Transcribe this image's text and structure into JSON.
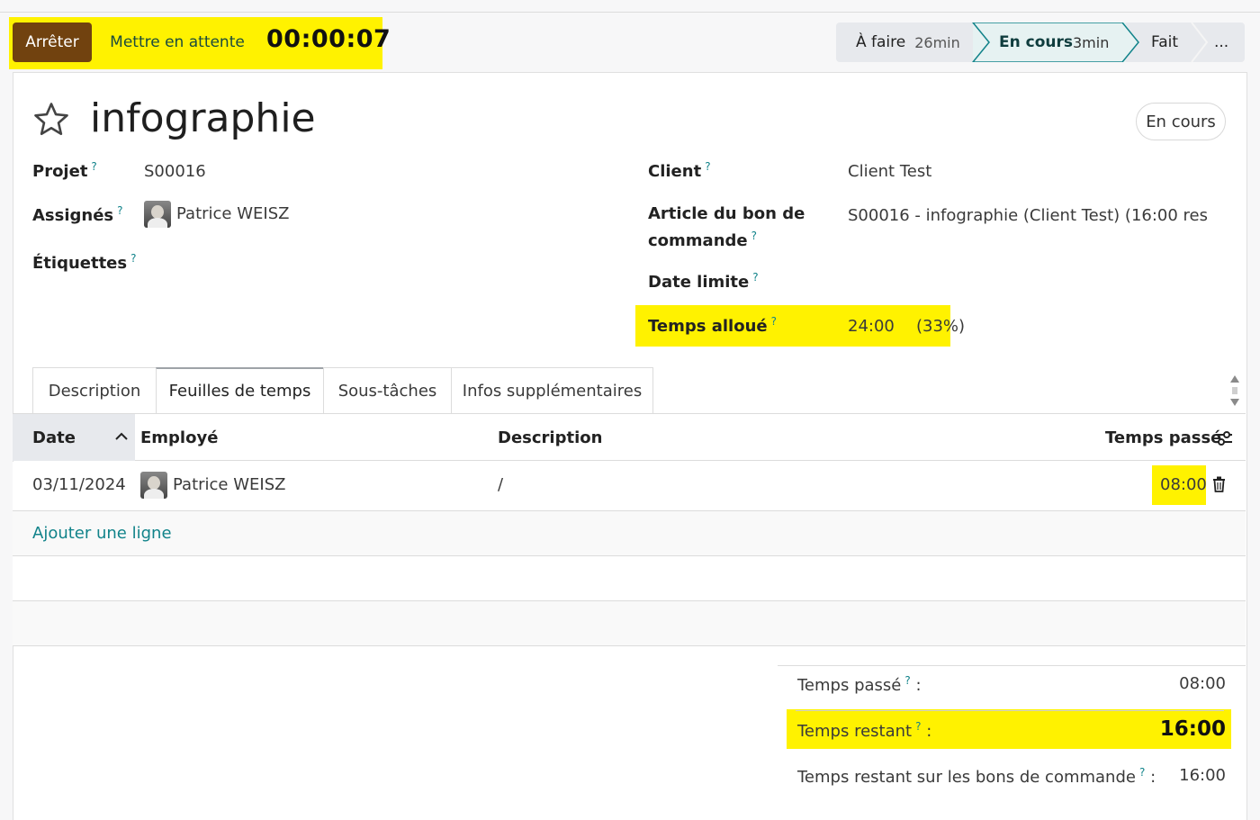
{
  "controls": {
    "stop_label": "Arrêter",
    "pause_label": "Mettre en attente",
    "timer": "00:00:07"
  },
  "stages": [
    {
      "label": "À faire",
      "time": "26min"
    },
    {
      "label": "En cours",
      "time": "3min"
    },
    {
      "label": "Fait",
      "time": ""
    },
    {
      "label": "...",
      "time": ""
    }
  ],
  "task": {
    "title": "infographie",
    "status_badge": "En cours"
  },
  "fields": {
    "projet_label": "Projet",
    "projet_value": "S00016",
    "assignes_label": "Assignés",
    "assignes_value": "Patrice WEISZ",
    "etiquettes_label": "Étiquettes",
    "client_label": "Client",
    "client_value": "Client Test",
    "article_label_1": "Article du bon de",
    "article_label_2": "commande",
    "article_value": "S00016 - infographie (Client Test) (16:00 res",
    "date_limite_label": "Date limite",
    "temps_alloue_label": "Temps alloué",
    "temps_alloue_value": "24:00",
    "temps_alloue_pct": "(33%)",
    "help_mark": "?"
  },
  "tabs": [
    {
      "label": "Description"
    },
    {
      "label": "Feuilles de temps"
    },
    {
      "label": "Sous-tâches"
    },
    {
      "label": "Infos supplémentaires"
    }
  ],
  "table": {
    "columns": [
      "Date",
      "Employé",
      "Description",
      "Temps passé"
    ],
    "rows": [
      {
        "date": "03/11/2024",
        "employee": "Patrice WEISZ",
        "description": "/",
        "time": "08:00"
      }
    ],
    "add_line": "Ajouter une ligne"
  },
  "totals": {
    "temps_passe_label": "Temps passé",
    "temps_passe_value": "08:00",
    "temps_restant_label": "Temps restant",
    "temps_restant_value": "16:00",
    "temps_restant_bc_label": "Temps restant sur les bons de commande",
    "temps_restant_bc_value": "16:00",
    "colon": ":"
  },
  "colors": {
    "highlight": "#fff200",
    "stop_button": "#71420f",
    "accent": "#11838a"
  }
}
